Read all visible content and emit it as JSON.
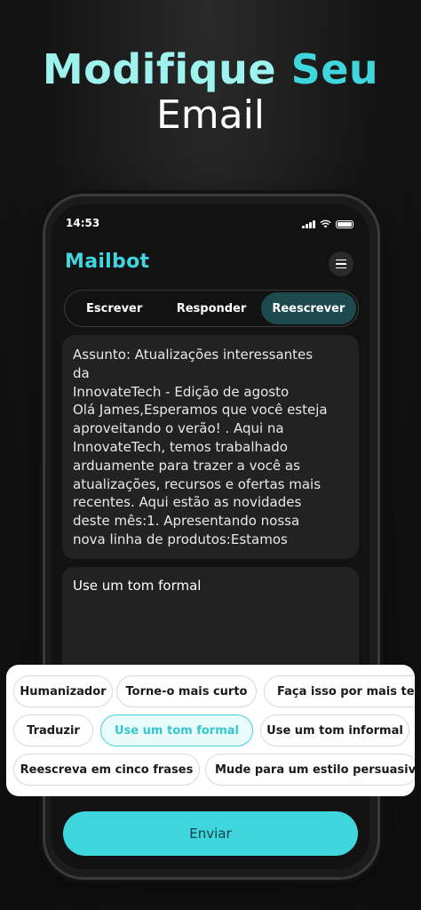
{
  "headline": {
    "word1": "Modifique",
    "word2": "Seu",
    "line2": "Email"
  },
  "status": {
    "time": "14:53"
  },
  "app": {
    "brand": "Mailbot",
    "menu_icon": "hamburger-menu-icon"
  },
  "tabs": [
    {
      "label": "Escrever",
      "active": false
    },
    {
      "label": "Responder",
      "active": false
    },
    {
      "label": "Reescrever",
      "active": true
    }
  ],
  "email": {
    "lines": [
      "Assunto: Atualizações interessantes",
      "da",
      "InnovateTech - Edição de agosto",
      "Olá James,Esperamos que você esteja",
      "aproveitando o verão! . Aqui na",
      "InnovateTech, temos trabalhado",
      "arduamente para trazer a você as",
      "atualizações, recursos e ofertas mais",
      "recentes. Aqui estão as novidades",
      "deste mês:1. Apresentando nossa",
      "nova linha de produtos:Estamos"
    ]
  },
  "instruction": {
    "value": "Use um tom formal"
  },
  "chips": [
    {
      "label": "Humanizador",
      "selected": false
    },
    {
      "label": "Torne-o mais curto",
      "selected": false
    },
    {
      "label": "Faça isso por mais tem",
      "selected": false
    },
    {
      "label": "Traduzir",
      "selected": false
    },
    {
      "label": "Use um tom formal",
      "selected": true
    },
    {
      "label": "Use um tom informal",
      "selected": false
    },
    {
      "label": "Reescreva em cinco frases",
      "selected": false
    },
    {
      "label": "Mude para um estilo persuasivo",
      "selected": false
    }
  ],
  "send_button": {
    "label": "Enviar"
  },
  "colors": {
    "accent": "#3fd6dd",
    "active_tab": "#1d4a4e",
    "card": "#222222",
    "background": "#121212"
  }
}
